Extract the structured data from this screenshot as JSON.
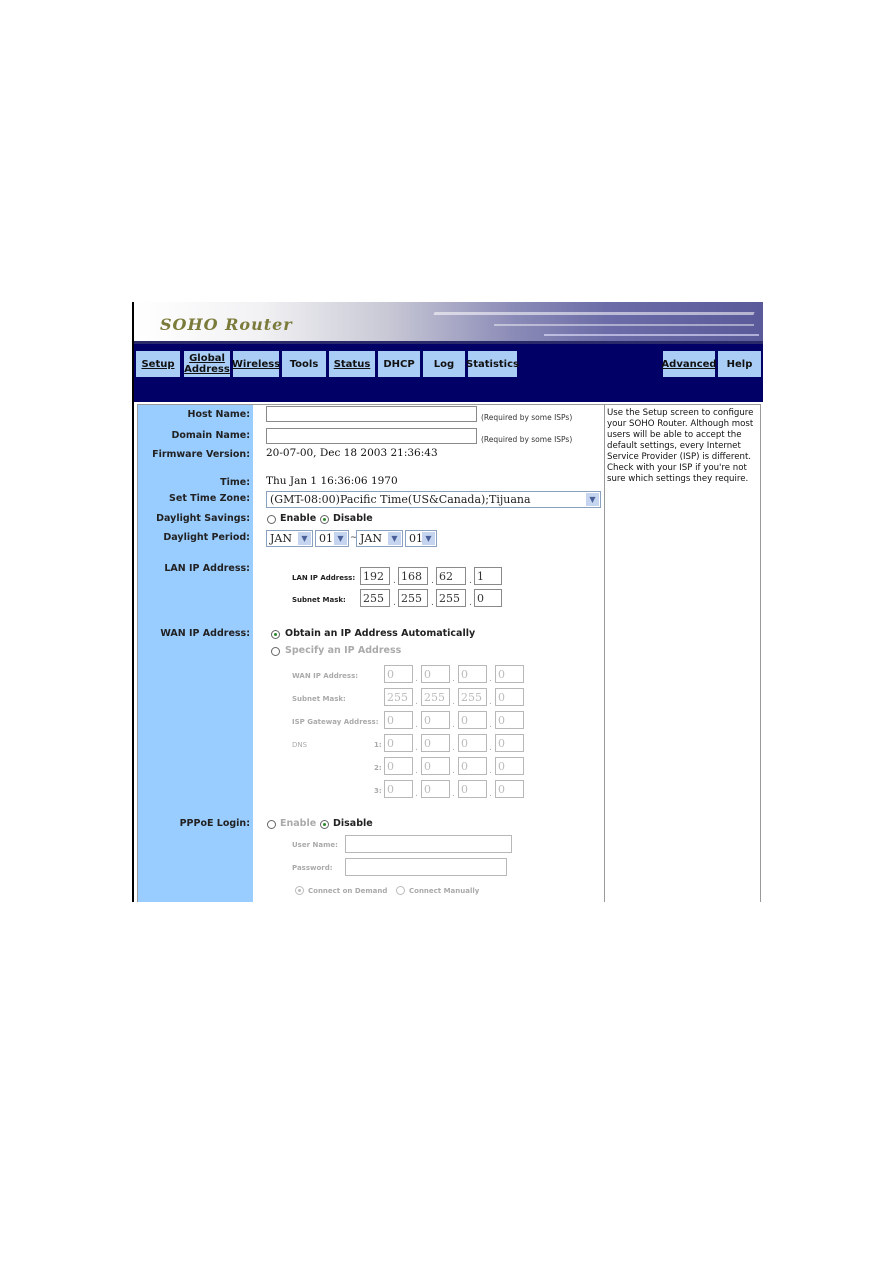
{
  "app": {
    "logo": "SOHO Router"
  },
  "nav": {
    "items": [
      {
        "label": "Setup",
        "underlined": true
      },
      {
        "label": "Global Address",
        "line1": "Global",
        "line2": "Address",
        "underlined": true
      },
      {
        "label": "Wireless",
        "underlined": true
      },
      {
        "label": "Tools",
        "underlined": false
      },
      {
        "label": "Status",
        "underlined": true
      },
      {
        "label": "DHCP",
        "underlined": false
      },
      {
        "label": "Log",
        "underlined": false
      },
      {
        "label": "Statistics",
        "underlined": false
      },
      {
        "label": "Advanced",
        "underlined": true
      },
      {
        "label": "Help",
        "underlined": false
      }
    ]
  },
  "form": {
    "host_name": {
      "label": "Host Name:",
      "value": "",
      "note": "(Required by some ISPs)"
    },
    "domain_name": {
      "label": "Domain Name:",
      "value": "",
      "note": "(Required by some ISPs)"
    },
    "firmware": {
      "label": "Firmware Version:",
      "value": "20-07-00, Dec 18 2003 21:36:43"
    },
    "time": {
      "label": "Time:",
      "value": "Thu Jan 1 16:36:06 1970"
    },
    "time_zone": {
      "label": "Set Time Zone:",
      "value": "(GMT-08:00)Pacific Time(US&Canada);Tijuana"
    },
    "daylight_savings": {
      "label": "Daylight Savings:",
      "enable": "Enable",
      "disable": "Disable",
      "selected": "Disable"
    },
    "daylight_period": {
      "label": "Daylight Period:",
      "start_month": "JAN",
      "start_day": "01",
      "separator": "~",
      "end_month": "JAN",
      "end_day": "01"
    },
    "lan": {
      "label": "LAN IP Address:",
      "ip_label": "LAN IP Address:",
      "ip": [
        "192",
        "168",
        "62",
        "1"
      ],
      "mask_label": "Subnet Mask:",
      "mask": [
        "255",
        "255",
        "255",
        "0"
      ]
    },
    "wan": {
      "label": "WAN IP Address:",
      "auto_option": "Obtain an IP Address Automatically",
      "specify_option": "Specify an IP Address",
      "selected": "auto",
      "ip_label": "WAN IP Address:",
      "ip": [
        "0",
        "0",
        "0",
        "0"
      ],
      "mask_label": "Subnet Mask:",
      "mask": [
        "255",
        "255",
        "255",
        "0"
      ],
      "gateway_label": "ISP Gateway Address:",
      "gateway": [
        "0",
        "0",
        "0",
        "0"
      ],
      "dns_label": "DNS",
      "dns1_label": "1:",
      "dns1": [
        "0",
        "0",
        "0",
        "0"
      ],
      "dns2_label": "2:",
      "dns2": [
        "0",
        "0",
        "0",
        "0"
      ],
      "dns3_label": "3:",
      "dns3": [
        "0",
        "0",
        "0",
        "0"
      ]
    },
    "pppoe": {
      "label": "PPPoE Login:",
      "enable": "Enable",
      "disable": "Disable",
      "selected": "Disable",
      "user_label": "User Name:",
      "user_value": "",
      "password_label": "Password:",
      "password_value": "",
      "connect_demand": "Connect on Demand",
      "connect_manual": "Connect Manually",
      "connect_selected": "demand"
    }
  },
  "help": {
    "text": "Use the Setup screen to configure your SOHO Router. Although most users will be able to accept the default settings, every Internet Service Provider (ISP) is different. Check with your ISP if you're not sure which settings they require."
  },
  "colors": {
    "navbar": "#000066",
    "nav_button": "#a9cdf5",
    "sidebar": "#99ccff"
  }
}
